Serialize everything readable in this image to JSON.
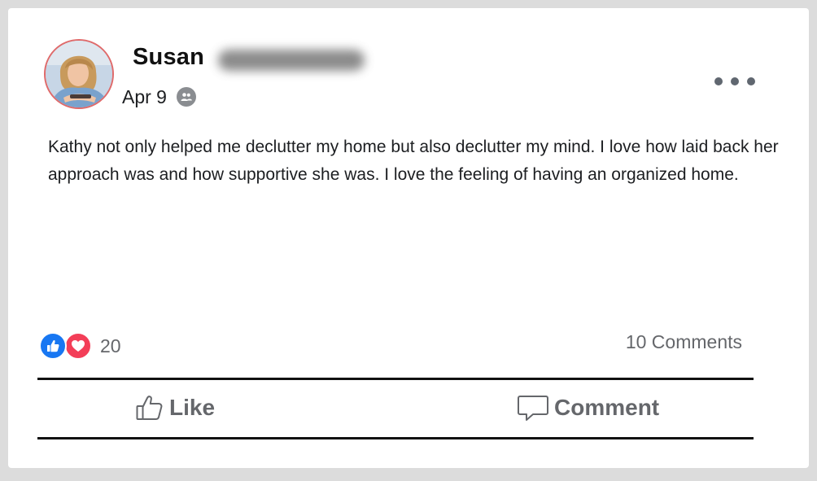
{
  "post": {
    "author_name": "Susan",
    "date": "Apr 9",
    "audience_icon": "friends-icon",
    "text": "Kathy not only helped me declutter my home but also declutter my mind. I love how laid back her approach was and how supportive she was. I love the feeling of having an organized home."
  },
  "reactions": {
    "icons": [
      "like-reaction-icon",
      "love-reaction-icon"
    ],
    "count": "20",
    "comments_label": "10 Comments"
  },
  "actions": {
    "like_label": "Like",
    "comment_label": "Comment"
  },
  "colors": {
    "like_blue": "#1877f2",
    "love_red": "#f33e58",
    "secondary_text": "#65676b",
    "background": "#dcdcdc"
  }
}
